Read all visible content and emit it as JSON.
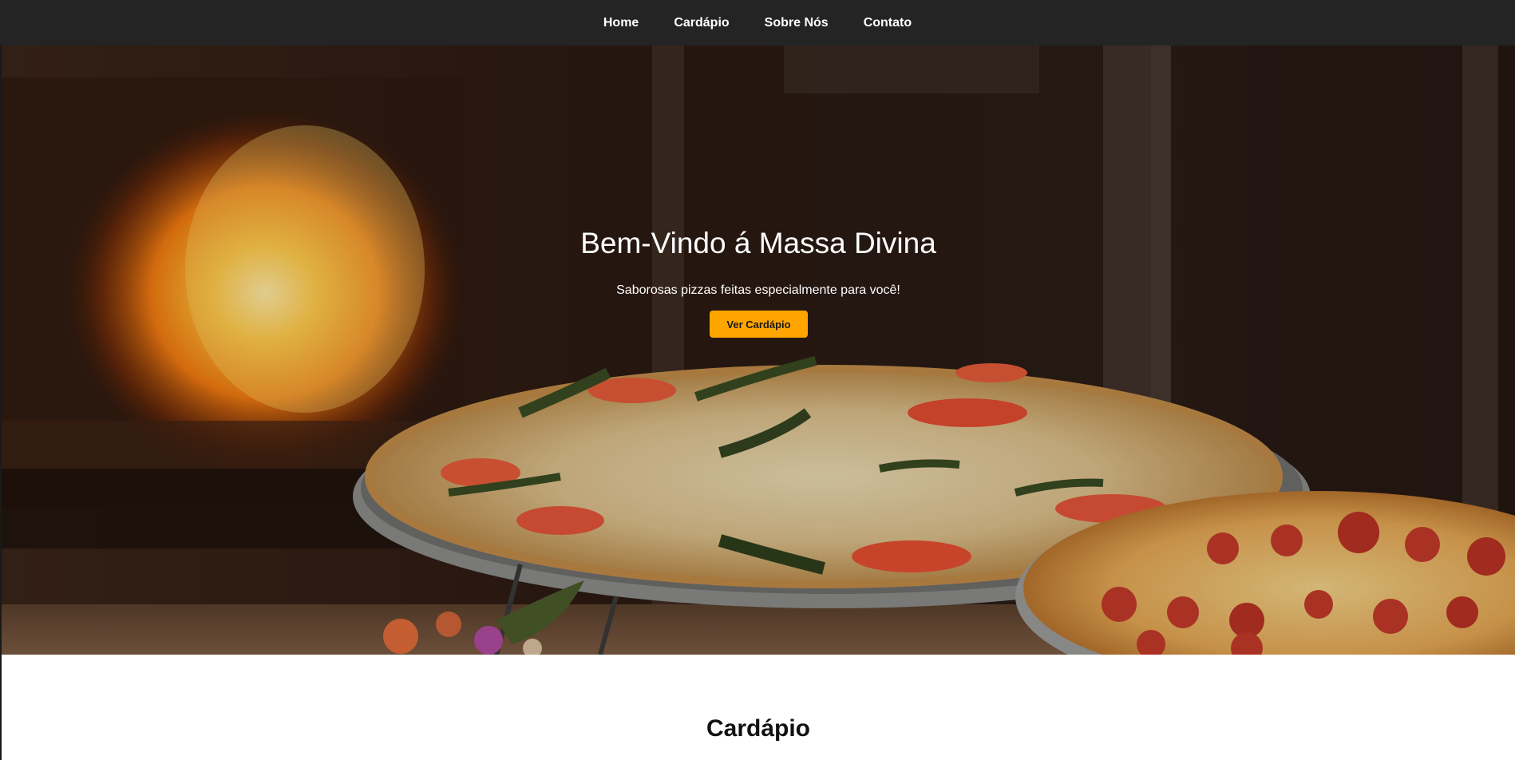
{
  "nav": {
    "items": [
      {
        "label": "Home"
      },
      {
        "label": "Cardápio"
      },
      {
        "label": "Sobre Nós"
      },
      {
        "label": "Contato"
      }
    ]
  },
  "hero": {
    "title": "Bem-Vindo á Massa Divina",
    "subtitle": "Saborosas pizzas feitas especialmente para você!",
    "button_label": "Ver Cardápio",
    "image": "pizza-oven-photo"
  },
  "menu_section": {
    "title": "Cardápio"
  },
  "colors": {
    "navbar_bg": "#242424",
    "accent": "#ffa500",
    "text_light": "#ffffff",
    "text_dark": "#111111"
  }
}
